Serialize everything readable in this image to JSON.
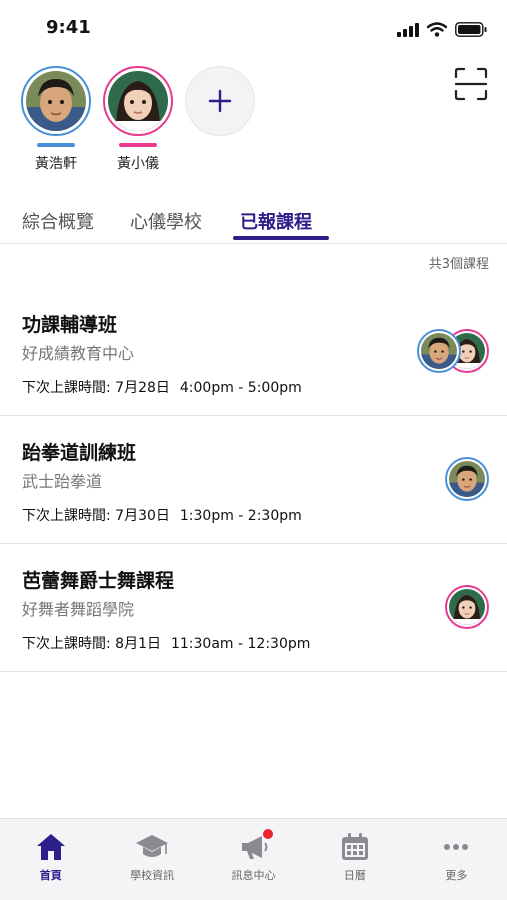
{
  "status_bar": {
    "time": "9:41"
  },
  "children": [
    {
      "name": "黃浩軒",
      "ring_color": "#4a90d9",
      "bar_color": "#4a90d9"
    },
    {
      "name": "黃小儀",
      "ring_color": "#e8398f",
      "bar_color": "#e8398f"
    }
  ],
  "add_child_icon": "plus-icon",
  "scan_icon": "scan-icon",
  "tabs": [
    {
      "label": "綜合概覽",
      "active": false
    },
    {
      "label": "心儀學校",
      "active": false
    },
    {
      "label": "已報課程",
      "active": true
    }
  ],
  "course_count": "共3個課程",
  "courses": [
    {
      "title": "功課輔導班",
      "provider": "好成績教育中心",
      "time_label": "下次上課時間: 7月28日",
      "time_range": "4:00pm - 5:00pm",
      "children": [
        "黃浩軒",
        "黃小儀"
      ]
    },
    {
      "title": "跆拳道訓練班",
      "provider": "武士跆拳道",
      "time_label": "下次上課時間: 7月30日",
      "time_range": "1:30pm - 2:30pm",
      "children": [
        "黃浩軒"
      ]
    },
    {
      "title": "芭蕾舞爵士舞課程",
      "provider": "好舞者舞蹈學院",
      "time_label": "下次上課時間: 8月1日",
      "time_range": "11:30am - 12:30pm",
      "children": [
        "黃小儀"
      ]
    }
  ],
  "nav": [
    {
      "label": "首頁",
      "icon": "home-icon",
      "active": true
    },
    {
      "label": "學校資訊",
      "icon": "graduation-cap-icon",
      "active": false
    },
    {
      "label": "訊息中心",
      "icon": "megaphone-icon",
      "active": false,
      "badge": true
    },
    {
      "label": "日曆",
      "icon": "calendar-icon",
      "active": false
    },
    {
      "label": "更多",
      "icon": "more-icon",
      "active": false
    }
  ],
  "colors": {
    "accent": "#2c1f8a",
    "boy": "#4a90d9",
    "girl": "#e8398f",
    "badge": "#e8242f"
  }
}
